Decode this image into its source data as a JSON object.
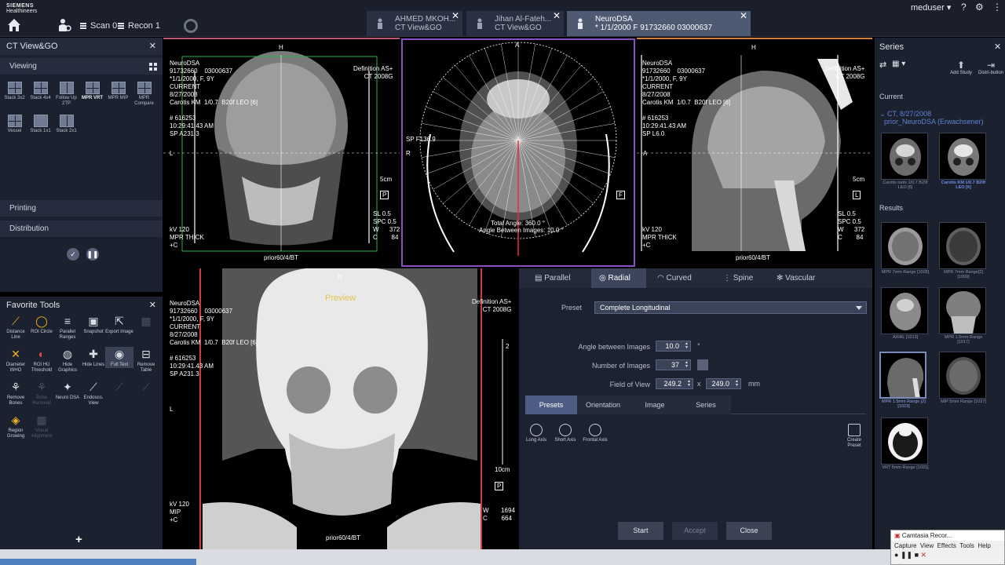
{
  "app": {
    "brand_line1": "SIEMENS",
    "brand_line2": "Healthineers",
    "scan_label": "Scan 0",
    "recon_label": "Recon 1",
    "user": "meduser",
    "help": "?"
  },
  "patient_tabs": [
    {
      "name": "AHMED MKOH...",
      "sub": "CT View&GO"
    },
    {
      "name": "Jihan Al-Fateh...",
      "sub": "CT View&GO"
    },
    {
      "name": "NeuroDSA",
      "sub": "* 1/1/2000 F 91732660     03000637"
    }
  ],
  "left_panel": {
    "title": "CT View&GO",
    "viewing": "Viewing",
    "layouts": [
      "Stack 3x2",
      "Stack 4x4",
      "Follow Up 2TP",
      "MPR VRT",
      "MPR MIP",
      "MPR Compare",
      "Vessel",
      "Stack 1x1",
      "Stack 2x1"
    ],
    "printing": "Printing",
    "distribution": "Distribution"
  },
  "favorite_tools": {
    "title": "Favorite Tools",
    "tools": [
      "Distance Line",
      "ROI Circle",
      "Parallel Ranges",
      "Snapshot",
      "Export Image",
      "Diameter WHO",
      "ROI HU Threshold",
      "Hide Graphics",
      "Hide Lines",
      "Full Text",
      "Remove Table",
      "Remove Bones",
      "Bone Removal",
      "Neuro DSA",
      "Endosco. View",
      "Region Growing",
      "Visual Alignment"
    ]
  },
  "viewports": {
    "coronal": {
      "top": "H",
      "left": "L",
      "tl": "NeuroDSA\n91732660    03000637\n*1/1/2000, F, 9Y\nCURRENT\n8/27/2008\nCarotis KM  1/0.7  B20f LEO [6]\n\n# 616253\n10:29:41.43 AM\nSP A231.3",
      "tr": "Definition AS+\nCT 2008G",
      "bl": "kV 120\nMPR THICK\n+C",
      "br": "SL 0.5\nSPC 0.5\nW      372\nC        84",
      "scale": "5cm",
      "bottom": "prior60/4/BT",
      "orient": "P"
    },
    "axial": {
      "top": "A",
      "left": "R",
      "pos": "SP F136.9",
      "total_angle": "Total Angle: 360.0 °",
      "angle_between": "Angle Between Images: 10.0 °",
      "orient": "F"
    },
    "sagittal": {
      "top": "H",
      "left": "A",
      "tl": "NeuroDSA\n91732660    03000637\n*1/1/2000, F, 9Y\nCURRENT\n8/27/2008\nCarotis KM  1/0.7  B20f LEO [6]\n\n# 616253\n10:29:41.43 AM\nSP L6.0",
      "tr": "Definition AS+\nCT 2008G",
      "bl": "kV 120\nMPR THICK\n+C",
      "br": "SL 0.5\nSPC 0.5\nW      372\nC        84",
      "scale": "5cm",
      "bottom": "prior60/4/BT",
      "orient": "L"
    },
    "vrt": {
      "top": "H",
      "left": "L",
      "preview": "Preview",
      "tl": "NeuroDSA\n91732660    03000637\n*1/1/2000, F, 9Y\nCURRENT\n8/27/2008\nCarotis KM  1/0.7  B20f LEO [6]\n\n# 616253\n10:29:41.43 AM\nSP A231.3",
      "tr": "Definition AS+\nCT 2008G",
      "bl": "kV 120\nMIP\n+C",
      "br": "W       1694\nC        664",
      "scale": "10cm",
      "bottom": "prior60/4/BT",
      "orient": "P",
      "ruler_num": "2"
    }
  },
  "radial_panel": {
    "tabs": [
      "Parallel",
      "Radial",
      "Curved",
      "Spine",
      "Vascular"
    ],
    "preset_label": "Preset",
    "preset_value": "Complete Longitudinal",
    "angle_label": "Angle between Images",
    "angle_value": "10.0",
    "angle_unit": "°",
    "count_label": "Number of Images",
    "count_value": "37",
    "fov_label": "Field of View",
    "fov_x": "249.2",
    "fov_sep": "x",
    "fov_y": "249.0",
    "fov_unit": "mm",
    "subtabs": [
      "Presets",
      "Orientation",
      "Image",
      "Series"
    ],
    "presets": [
      "Long Axis",
      "Short Axis",
      "Frontal Axis"
    ],
    "create_preset": "Create Preset",
    "start": "Start",
    "accept": "Accept",
    "close": "Close"
  },
  "series_panel": {
    "title": "Series",
    "add_study": "Add Study",
    "distribution": "Distri-bution",
    "current": "Current",
    "study": "CT, 8/27/2008",
    "prior": "prior_NeuroDSA (Erwachsener)",
    "current_thumbs": [
      "Carotis nativ  1/0.7  B20f LEO [6]",
      "Carotis KM  1/0.7  B20f LEO [6]"
    ],
    "results": "Results",
    "result_thumbs": [
      "MPR 7mm Range [1005]",
      "MPR 7mm Range[2] [1009]",
      "AXIAL [1013]",
      "MPR 1.5mm Range [1017]",
      "MPR 1.5mm Range [2] [1023]",
      "MIP 5mm Range [1027]",
      "VRT 5mm Range [1031]"
    ]
  },
  "recorder": {
    "title": "Camtasia Recor...",
    "menu": [
      "Capture",
      "View",
      "Effects",
      "Tools",
      "Help"
    ]
  }
}
